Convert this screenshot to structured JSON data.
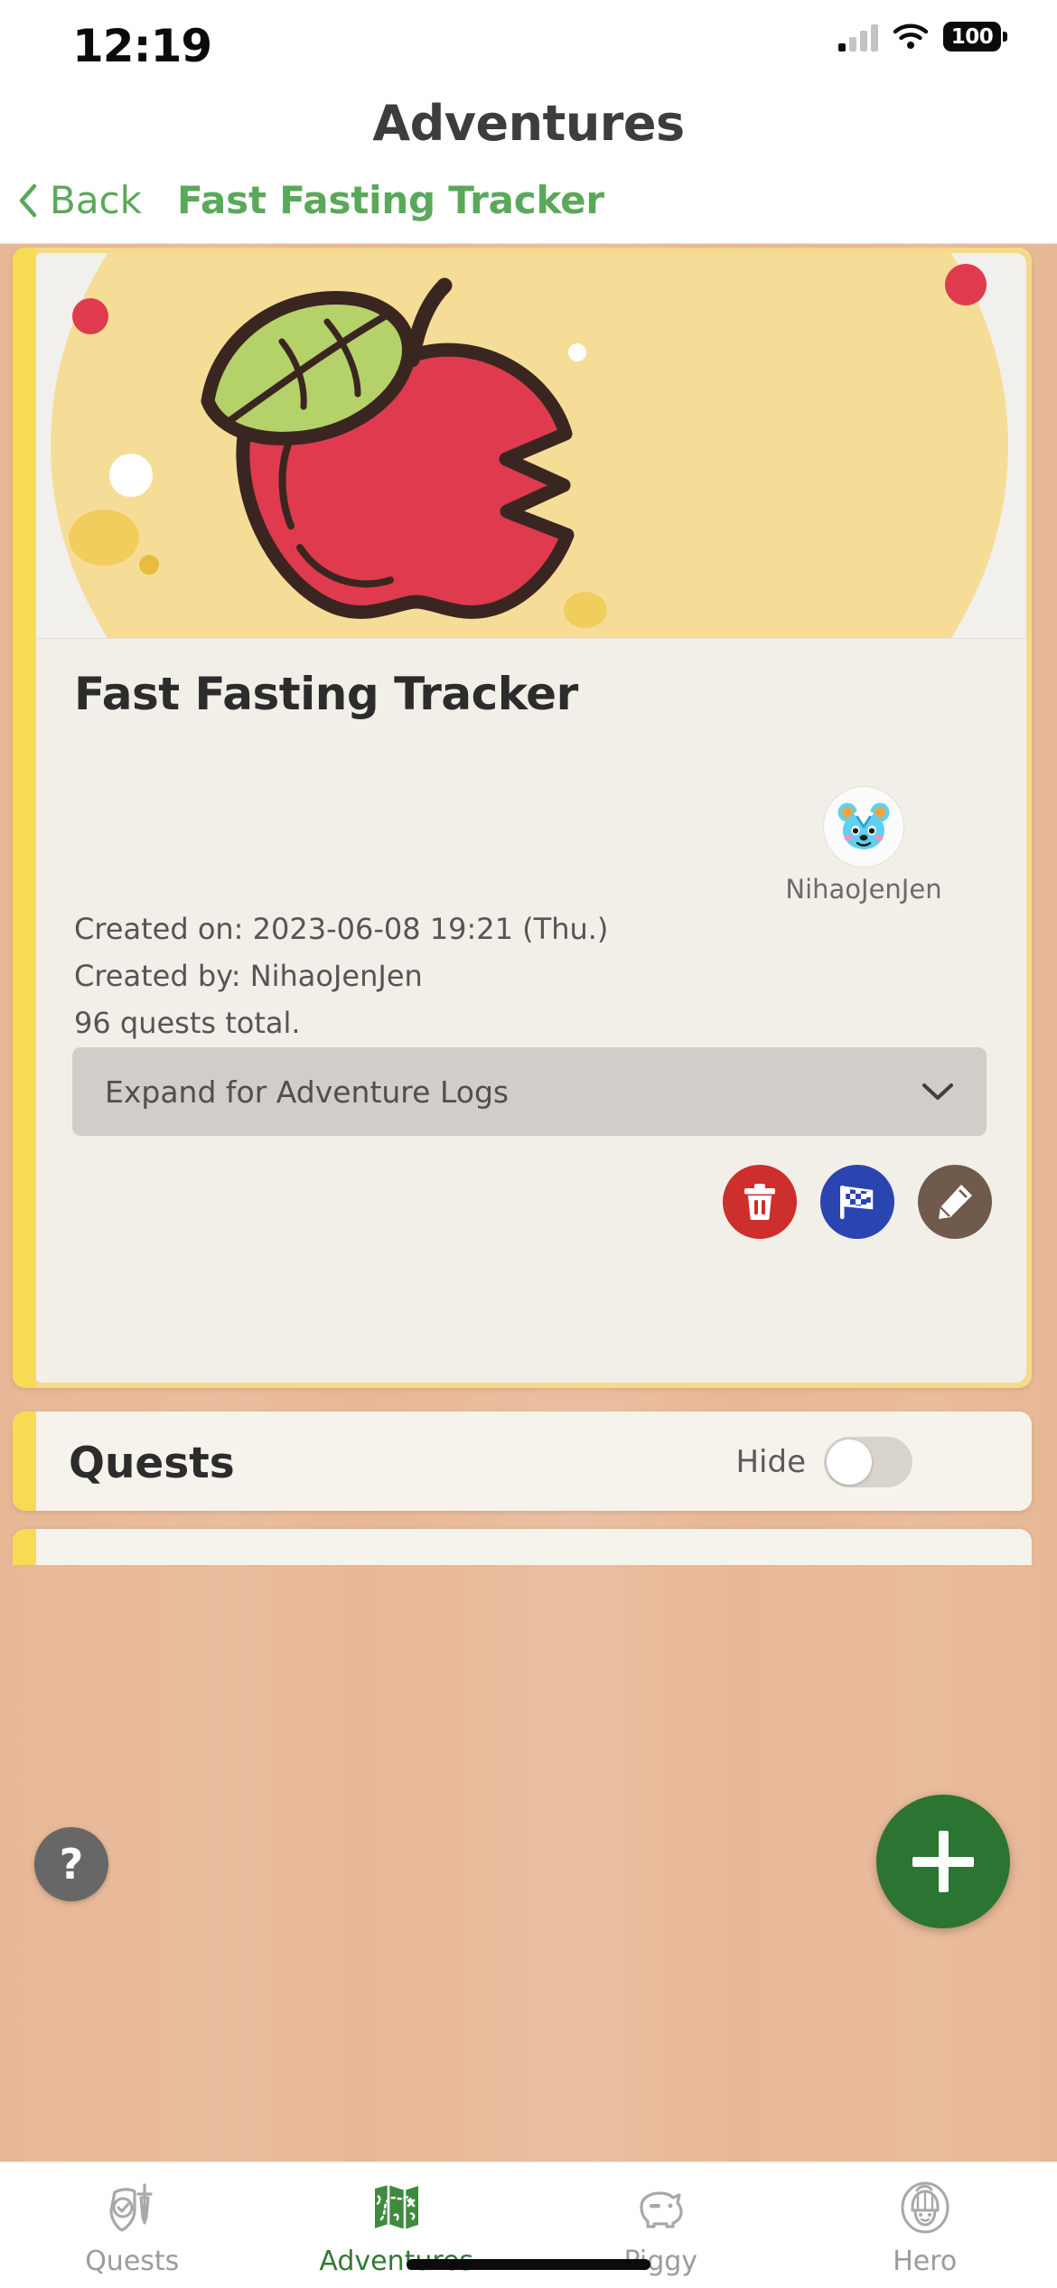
{
  "status_bar": {
    "time": "12:19",
    "battery_percent": "100",
    "cellular_icon": "cellular-signal-icon",
    "wifi_icon": "wifi-icon",
    "battery_icon": "battery-icon"
  },
  "header": {
    "title": "Adventures"
  },
  "subnav": {
    "back_label": "Back",
    "back_icon": "chevron-left-icon",
    "title": "Fast Fasting Tracker"
  },
  "adventure_card": {
    "hero_icon": "apple-illustration",
    "title": "Fast Fasting Tracker",
    "creator": {
      "avatar_icon": "blue-bear-avatar",
      "name": "NihaoJenJen"
    },
    "meta": {
      "created_on": "Created on: 2023-06-08 19:21 (Thu.)",
      "created_by": "Created by: NihaoJenJen",
      "quest_count": "96 quests total."
    },
    "expand": {
      "label": "Expand for Adventure Logs",
      "chevron_icon": "chevron-down-icon"
    },
    "actions": [
      {
        "name": "delete",
        "icon": "trash-icon",
        "color": "#cc2f2c"
      },
      {
        "name": "complete",
        "icon": "checkered-flag-icon",
        "color": "#2a44b0"
      },
      {
        "name": "edit",
        "icon": "pencil-icon",
        "color": "#6f5a4b"
      }
    ]
  },
  "second_card": {
    "title": "Quests",
    "hide_label": "Hide",
    "hide_toggle_state": "off"
  },
  "floating": {
    "help_label": "?",
    "add_icon": "plus-icon",
    "add_color": "#2c7431"
  },
  "tabbar": {
    "items": [
      {
        "label": "Quests",
        "icon": "shield-sword-icon",
        "active": false
      },
      {
        "label": "Adventures",
        "icon": "treasure-map-icon",
        "active": true
      },
      {
        "label": "Piggy",
        "icon": "piggy-bank-icon",
        "active": false
      },
      {
        "label": "Hero",
        "icon": "knight-helmet-icon",
        "active": false
      }
    ]
  },
  "colors": {
    "accent_green": "#5aa85a",
    "tab_active_green": "#2f7a33",
    "card_stripe_yellow": "#f5dc54",
    "page_background": "#e8b896"
  }
}
